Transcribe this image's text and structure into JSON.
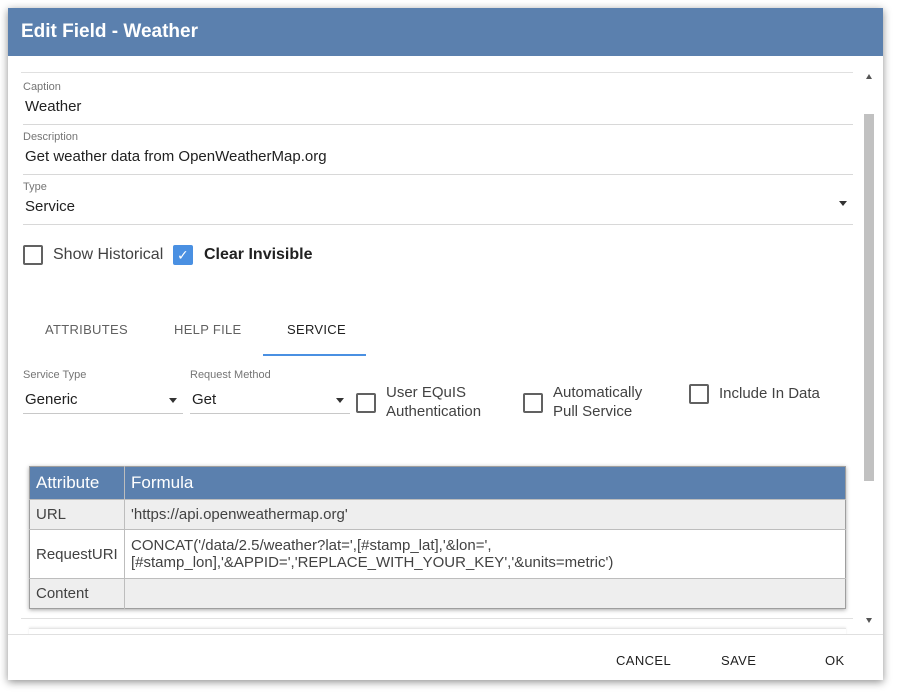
{
  "dialog": {
    "title": "Edit Field - Weather"
  },
  "fields": {
    "caption": {
      "label": "Caption",
      "value": "Weather"
    },
    "description": {
      "label": "Description",
      "value": "Get weather data from OpenWeatherMap.org"
    },
    "type": {
      "label": "Type",
      "value": "Service"
    }
  },
  "options": {
    "show_historical": {
      "label": "Show Historical",
      "checked": false
    },
    "clear_invisible": {
      "label": "Clear Invisible",
      "checked": true
    }
  },
  "tabs": [
    {
      "label": "ATTRIBUTES",
      "active": false
    },
    {
      "label": "HELP FILE",
      "active": false
    },
    {
      "label": "SERVICE",
      "active": true
    }
  ],
  "service": {
    "service_type": {
      "label": "Service Type",
      "value": "Generic"
    },
    "request_method": {
      "label": "Request Method",
      "value": "Get"
    },
    "user_equis_auth": {
      "label_line1": "User EQuIS",
      "label_line2": "Authentication",
      "checked": false
    },
    "auto_pull": {
      "label_line1": "Automatically",
      "label_line2": "Pull Service",
      "checked": false
    },
    "include_in_data": {
      "label": "Include In Data",
      "checked": false
    }
  },
  "table": {
    "headers": [
      "Attribute",
      "Formula"
    ],
    "rows": [
      {
        "attribute": "URL",
        "formula": "'https://api.openweathermap.org'"
      },
      {
        "attribute": "RequestURI",
        "formula_line1": "CONCAT('/data/2.5/weather?lat=',[#stamp_lat],'&lon=',",
        "formula_line2": "[#stamp_lon],'&APPID=','REPLACE_WITH_YOUR_KEY','&units=metric')"
      },
      {
        "attribute": "Content",
        "formula": ""
      }
    ]
  },
  "footer": {
    "cancel": "CANCEL",
    "save": "SAVE",
    "ok": "OK"
  },
  "colors": {
    "header": "#5b80ae",
    "accent": "#4a90e2"
  }
}
